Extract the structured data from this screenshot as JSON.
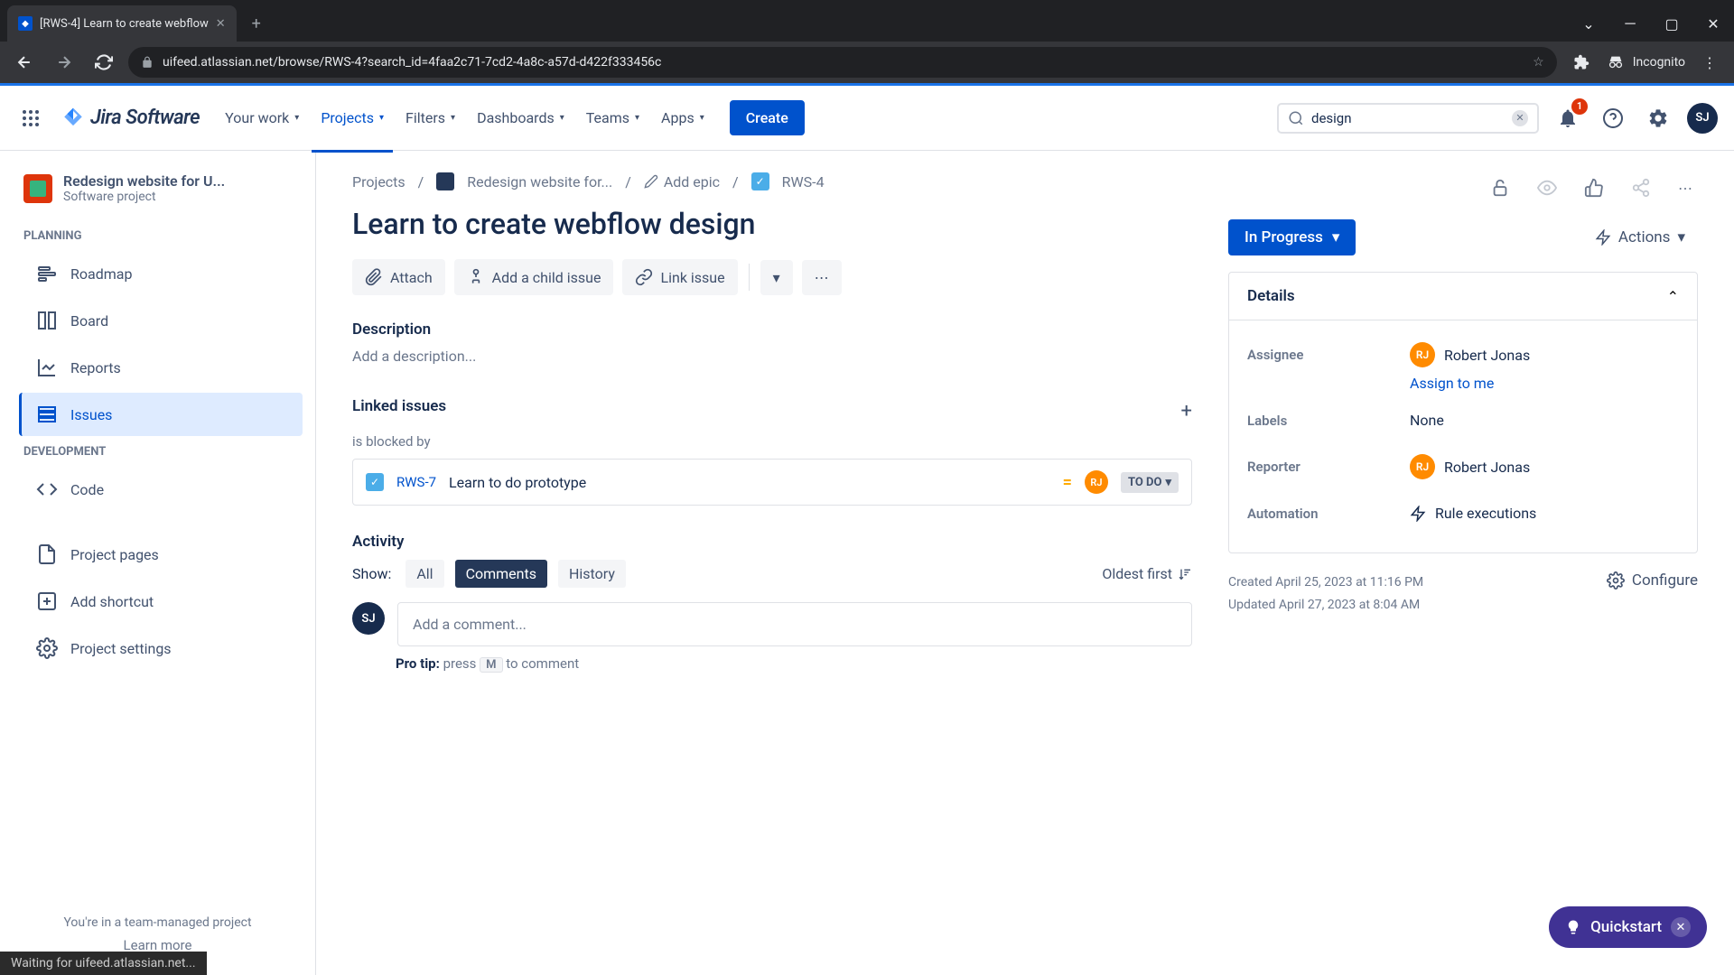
{
  "browser": {
    "tab_title": "[RWS-4] Learn to create webflow",
    "url_display": "uifeed.atlassian.net/browse/RWS-4?search_id=4faa2c71-7cd2-4a8c-a57d-d422f333456c",
    "incognito_label": "Incognito",
    "tabs_chevron": "⌄"
  },
  "nav": {
    "logo_text": "Jira Software",
    "items": [
      "Your work",
      "Projects",
      "Filters",
      "Dashboards",
      "Teams",
      "Apps"
    ],
    "active_index": 1,
    "create_label": "Create",
    "search_value": "design",
    "notification_count": "1",
    "user_initials": "SJ"
  },
  "sidebar": {
    "project_name": "Redesign website for U...",
    "project_type": "Software project",
    "planning_label": "PLANNING",
    "planning_items": [
      "Roadmap",
      "Board",
      "Reports",
      "Issues"
    ],
    "planning_selected": 3,
    "dev_label": "DEVELOPMENT",
    "dev_items": [
      "Code"
    ],
    "bottom_items": [
      "Project pages",
      "Add shortcut",
      "Project settings"
    ],
    "footer_text": "You're in a team-managed project",
    "footer_link": "Learn more"
  },
  "breadcrumb": {
    "projects": "Projects",
    "project_name": "Redesign website for...",
    "add_epic": "Add epic",
    "issue_key": "RWS-4"
  },
  "issue": {
    "title": "Learn to create webflow design",
    "attach": "Attach",
    "add_child": "Add a child issue",
    "link_issue": "Link issue",
    "description_label": "Description",
    "description_placeholder": "Add a description...",
    "linked_label": "Linked issues",
    "blocked_by": "is blocked by",
    "linked_item": {
      "key": "RWS-7",
      "summary": "Learn to do prototype",
      "status": "TO DO",
      "assignee_initials": "RJ"
    },
    "activity_label": "Activity",
    "show_label": "Show:",
    "tabs": [
      "All",
      "Comments",
      "History"
    ],
    "active_tab": 1,
    "sort_label": "Oldest first",
    "comment_placeholder": "Add a comment...",
    "pro_tip_prefix": "Pro tip:",
    "pro_tip_press": "press",
    "pro_tip_key": "M",
    "pro_tip_suffix": "to comment"
  },
  "side_panel": {
    "status": "In Progress",
    "actions": "Actions",
    "details_label": "Details",
    "assignee_label": "Assignee",
    "assignee_name": "Robert Jonas",
    "assignee_initials": "RJ",
    "assign_to_me": "Assign to me",
    "labels_label": "Labels",
    "labels_value": "None",
    "reporter_label": "Reporter",
    "reporter_name": "Robert Jonas",
    "automation_label": "Automation",
    "automation_value": "Rule executions",
    "created": "Created April 25, 2023 at 11:16 PM",
    "updated": "Updated April 27, 2023 at 8:04 AM",
    "configure": "Configure"
  },
  "quickstart": {
    "label": "Quickstart"
  },
  "status_bar": "Waiting for uifeed.atlassian.net..."
}
